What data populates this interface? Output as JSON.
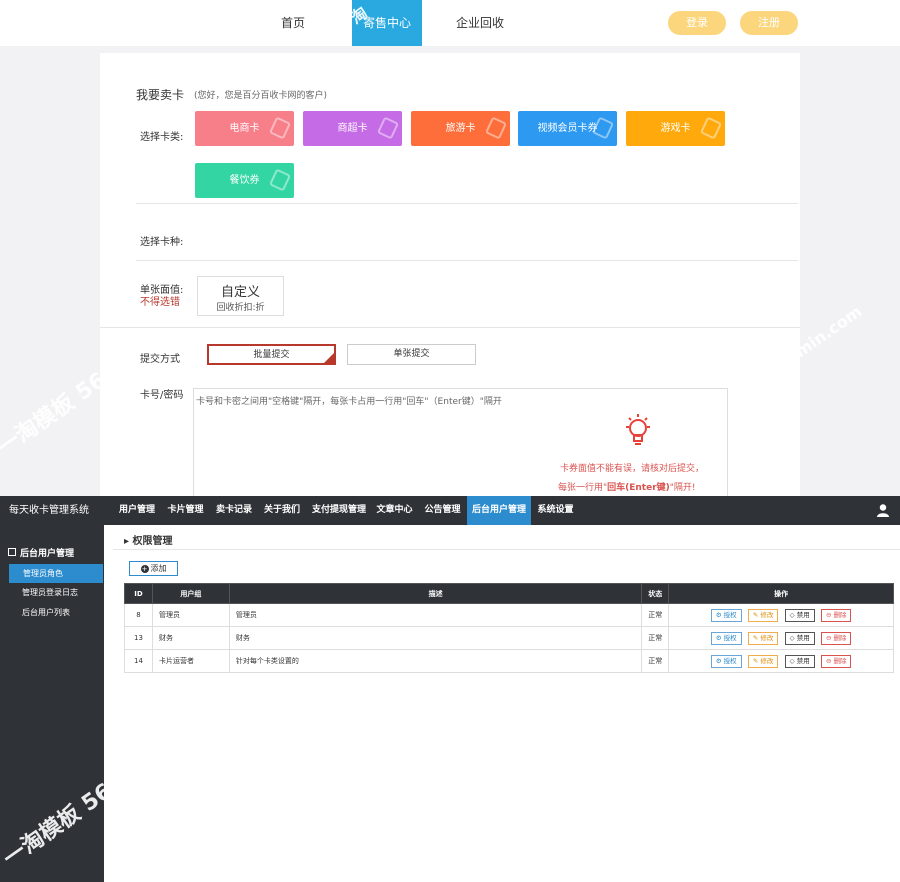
{
  "site": {
    "nav": [
      "首页",
      "寄售中心",
      "企业回收"
    ],
    "login": "登录",
    "register": "注册"
  },
  "sell": {
    "title": "我要卖卡",
    "subtitle": "(您好，您是百分百收卡网的客户)",
    "category_label": "选择卡类:",
    "categories": [
      {
        "label": "电商卡",
        "color": "#f77f8a"
      },
      {
        "label": "商超卡",
        "color": "#c56be6"
      },
      {
        "label": "旅游卡",
        "color": "#fd6e3b"
      },
      {
        "label": "视频会员卡券",
        "color": "#2d99f0"
      },
      {
        "label": "游戏卡",
        "color": "#ffa90d"
      },
      {
        "label": "餐饮券",
        "color": "#33d6a2"
      }
    ],
    "type_label": "选择卡种:",
    "value_label": "单张面值:",
    "value_note": "不得选错",
    "custom_title": "自定义",
    "custom_sub": "回收折扣:折",
    "submit_label": "提交方式",
    "submit_batch": "批量提交",
    "submit_single": "单张提交",
    "card_label": "卡号/密码",
    "card_placeholder": "卡号和卡密之间用\"空格键\"隔开，每张卡占用一行用\"回车\"（Enter键）\"隔开",
    "tip_line1": "卡券面值不能有误，请核对后提交，",
    "tip_line2_a": "每张一行用\"",
    "tip_line2_b": "回车(Enter键)",
    "tip_line2_c": "\"隔开!"
  },
  "watermarks": [
    "淘",
    "一淘模板 56a",
    "min.com",
    "一淘模板 56a"
  ],
  "admin": {
    "brand": "每天收卡管理系统",
    "topnav": [
      "用户管理",
      "卡片管理",
      "卖卡记录",
      "关于我们",
      "支付提现管理",
      "文章中心",
      "公告管理",
      "后台用户管理",
      "系统设置"
    ],
    "sidebar_head": "后台用户管理",
    "sidebar_items": [
      "管理员角色",
      "管理员登录日志",
      "后台用户列表"
    ],
    "breadcrumb": "权限管理",
    "add_label": "添加",
    "columns": [
      "ID",
      "用户组",
      "描述",
      "状态",
      "操作"
    ],
    "rows": [
      {
        "id": "8",
        "group": "管理员",
        "desc": "管理员",
        "status": "正常"
      },
      {
        "id": "13",
        "group": "财务",
        "desc": "财务",
        "status": "正常"
      },
      {
        "id": "14",
        "group": "卡片运营者",
        "desc": "针对每个卡类设置的",
        "status": "正常"
      }
    ],
    "ops": {
      "auth": "授权",
      "edit": "修改",
      "ban": "禁用",
      "del": "删除"
    }
  }
}
